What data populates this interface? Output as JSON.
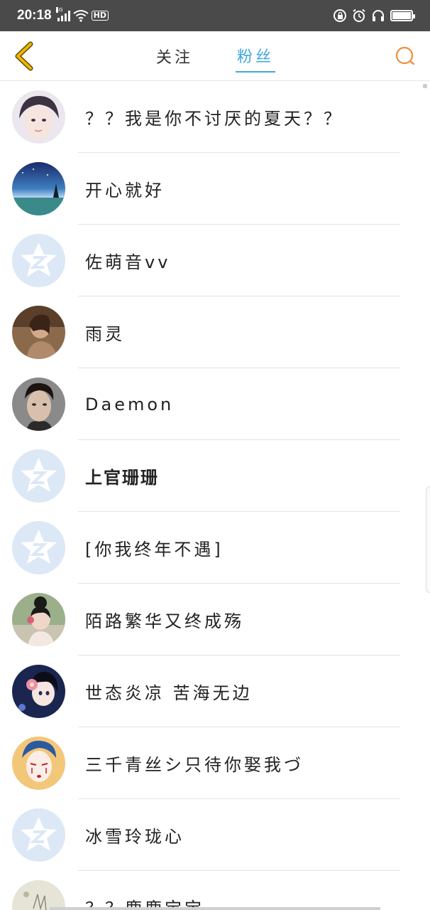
{
  "status_bar": {
    "time": "20:18",
    "network": "4G",
    "hd_label": "HD",
    "icons": [
      "signal-icon",
      "wifi-icon",
      "hd-icon",
      "lock-icon",
      "alarm-icon",
      "headphones-icon",
      "battery-icon"
    ]
  },
  "header": {
    "back_icon": "chevron-left-icon",
    "tabs": [
      {
        "label": "关注",
        "active": false
      },
      {
        "label": "粉丝",
        "active": true
      }
    ],
    "search_icon": "search-icon",
    "accent_color": "#3ea8de",
    "back_color": "#f0b400",
    "search_color": "#f08c3a"
  },
  "fans": [
    {
      "name": "？？我是你不讨厌的夏天？？",
      "avatar": "photo-girl"
    },
    {
      "name": "开心就好",
      "avatar": "photo-night-sky"
    },
    {
      "name": "佐萌音vv",
      "avatar": "default-qzone"
    },
    {
      "name": "雨灵",
      "avatar": "photo-woman-sepia"
    },
    {
      "name": "Daemon",
      "avatar": "photo-man-portrait"
    },
    {
      "name": "上官珊珊",
      "avatar": "default-qzone"
    },
    {
      "name": "[你我终年不遇]",
      "avatar": "default-qzone"
    },
    {
      "name": "陌路繁华又终成殇",
      "avatar": "photo-woman-hair-bun"
    },
    {
      "name": "世态炎凉 苦海无边",
      "avatar": "illustration-flower-girl"
    },
    {
      "name": "三千青丝シ只待你娶我づ",
      "avatar": "illustration-painted-face"
    },
    {
      "name": "冰雪玲珑心",
      "avatar": "default-qzone"
    },
    {
      "name": "？？鹿鹿宝宝",
      "avatar": "illustration-deer"
    }
  ]
}
